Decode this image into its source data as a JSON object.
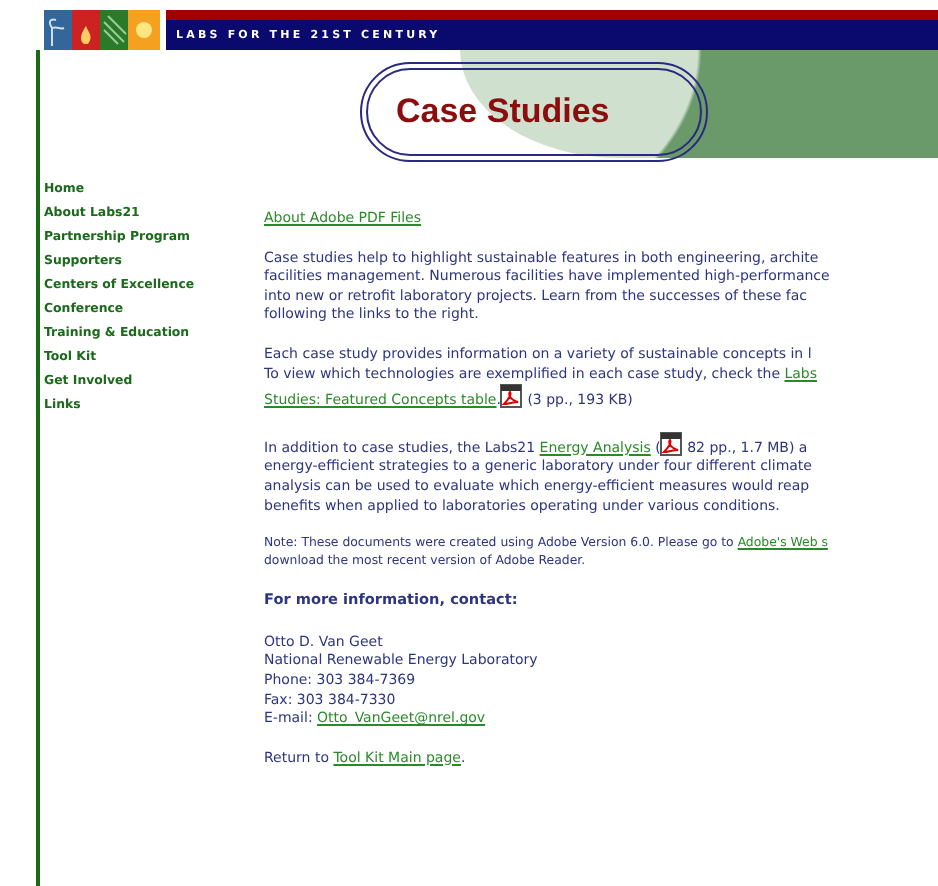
{
  "header": {
    "tagline": "LABS FOR THE 21ST CENTURY",
    "title": "Case Studies"
  },
  "nav": [
    {
      "label": "Home"
    },
    {
      "label": "About Labs21"
    },
    {
      "label": "Partnership Program"
    },
    {
      "label": "Supporters"
    },
    {
      "label": "Centers of Excellence"
    },
    {
      "label": "Conference"
    },
    {
      "label": "Training & Education"
    },
    {
      "label": "Tool Kit"
    },
    {
      "label": "Get Involved"
    },
    {
      "label": "Links"
    }
  ],
  "content": [
    {
      "kind": "body",
      "lines": [
        [
          {
            "kind": "link",
            "text": "About Adobe PDF Files"
          }
        ]
      ]
    },
    {
      "kind": "body",
      "lines": [
        [
          {
            "kind": "text",
            "text": "Case studies help to highlight sustainable features in both engineering, archite"
          }
        ],
        [
          {
            "kind": "text",
            "text": "facilities management. Numerous facilities have implemented high-performance"
          }
        ],
        [
          {
            "kind": "text",
            "text": "into new or retrofit laboratory projects. Learn from the successes of these fac"
          }
        ],
        [
          {
            "kind": "text",
            "text": "following the links to the right."
          }
        ]
      ]
    },
    {
      "kind": "body",
      "lines": [
        [
          {
            "kind": "text",
            "text": "Each case study provides information on a variety of sustainable concepts in l"
          }
        ],
        [
          {
            "kind": "text",
            "text": "To view which technologies are exemplified in each case study, check the "
          },
          {
            "kind": "link",
            "text": "Labs"
          }
        ],
        [
          {
            "kind": "link",
            "text": "Studies: Featured Concepts table"
          },
          {
            "kind": "text",
            "text": "."
          },
          {
            "kind": "pdf"
          },
          {
            "kind": "text",
            "text": " (3 pp., 193 KB)"
          }
        ]
      ]
    },
    {
      "kind": "body",
      "lines": [
        [
          {
            "kind": "text",
            "text": "In addition to case studies, the Labs21 "
          },
          {
            "kind": "link",
            "text": "Energy Analysis"
          },
          {
            "kind": "text",
            "text": " ("
          },
          {
            "kind": "pdf"
          },
          {
            "kind": "text",
            "text": " 82 pp., 1.7 MB) a"
          }
        ],
        [
          {
            "kind": "text",
            "text": "energy-efficient strategies to a generic laboratory under four different climate"
          }
        ],
        [
          {
            "kind": "text",
            "text": "analysis can be used to evaluate which energy-efficient measures would reap"
          }
        ],
        [
          {
            "kind": "text",
            "text": "benefits when applied to laboratories operating under various conditions."
          }
        ]
      ]
    },
    {
      "kind": "note",
      "lines": [
        [
          {
            "kind": "text",
            "text": "Note: These documents were created using Adobe Version 6.0. Please go to "
          },
          {
            "kind": "link",
            "text": "Adobe's Web s"
          }
        ],
        [
          {
            "kind": "text",
            "text": "download the most recent version of Adobe Reader."
          }
        ]
      ]
    },
    {
      "kind": "heading",
      "lines": [
        [
          {
            "kind": "text",
            "text": "For more information, contact:"
          }
        ]
      ]
    },
    {
      "kind": "body",
      "lines": [
        [
          {
            "kind": "text",
            "text": "Otto D. Van Geet"
          }
        ],
        [
          {
            "kind": "text",
            "text": "National Renewable Energy Laboratory"
          }
        ],
        [
          {
            "kind": "text",
            "text": "Phone: 303 384-7369"
          }
        ],
        [
          {
            "kind": "text",
            "text": "Fax: 303 384-7330"
          }
        ],
        [
          {
            "kind": "text",
            "text": "E-mail: "
          },
          {
            "kind": "link",
            "text": "Otto_VanGeet@nrel.gov"
          }
        ]
      ]
    },
    {
      "kind": "body",
      "lines": [
        [
          {
            "kind": "text",
            "text": "Return to "
          },
          {
            "kind": "link",
            "text": "Tool Kit Main page"
          },
          {
            "kind": "text",
            "text": "."
          }
        ]
      ]
    }
  ]
}
